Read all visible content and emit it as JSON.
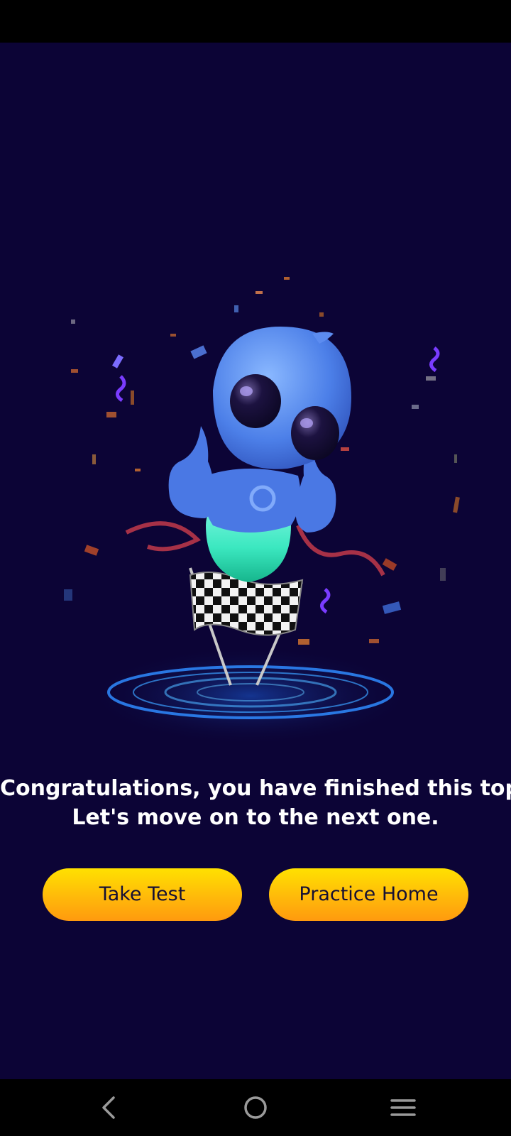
{
  "congrats": {
    "line1": "Congratulations, you have finished this topic.",
    "line2": "Let's move on to the next one."
  },
  "actions": {
    "take_test_label": "Take Test",
    "practice_home_label": "Practice Home"
  },
  "navigation": {
    "back_icon": "back-chevron-icon",
    "home_icon": "home-circle-icon",
    "menu_icon": "menu-lines-icon"
  },
  "colors": {
    "background": "#0c0436",
    "button_top": "#ffe100",
    "button_bottom": "#ff9a0e",
    "button_text": "#161033"
  }
}
